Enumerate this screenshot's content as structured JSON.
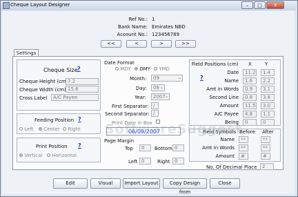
{
  "window": {
    "title": "Cheque Layout Designer",
    "minimize": "–",
    "maximize": "□",
    "close": "✕"
  },
  "header": {
    "ref_label": "Ref No.:",
    "ref_value": "1",
    "bank_label": "Bank Name:",
    "bank_value": "Emirates NBD",
    "account_label": "Account No.:",
    "account_value": "123456789"
  },
  "nav": {
    "first": "<<",
    "prev": "<",
    "next": ">",
    "last": ">>"
  },
  "tabs": {
    "settings": "Settings"
  },
  "cheque_size": {
    "title": "Cheque Size",
    "help": "?",
    "height_label": "Cheque Height (cm)",
    "height_value": "7.2",
    "width_label": "Cheque Width (cm)",
    "width_value": "15.6",
    "cross_label": "Cross Label",
    "cross_value": "A/C Payee"
  },
  "feeding": {
    "title": "Feeding Position",
    "help": "?",
    "left": "Left",
    "center": "Center",
    "right": "Right",
    "selected": "Center"
  },
  "print_position": {
    "title": "Print Position",
    "help": "?",
    "vertical": "Vertical",
    "horizontal": "Horizontal",
    "selected": "Vertical"
  },
  "date_format": {
    "title": "Date Format",
    "mdy": "MDY",
    "dmy": "DMY",
    "ymd": "YMD",
    "selected": "DMY",
    "month_label": "Month:",
    "month_value": "09",
    "day_label": "Day:",
    "day_value": "06",
    "year_label": "Year:",
    "year_value": "2007",
    "first_sep_label": "First Separator:",
    "first_sep_value": "/",
    "second_sep_label": "Second Separator:",
    "second_sep_value": "/",
    "print_in_box_label": "Print Date in Box",
    "preview": "06/09/2007"
  },
  "page_margin": {
    "title": "Page Margin",
    "top_label": "Top",
    "top_value": "0",
    "bottom_label": "Bottom",
    "bottom_value": "0",
    "left_label": "Left",
    "left_value": "0",
    "right_label": "Right",
    "right_value": "0"
  },
  "field_positions": {
    "title": "Field Positions (cm)",
    "help": "?",
    "col_x": "X",
    "col_y": "Y",
    "rows": [
      {
        "label": "Date",
        "x": "11.2",
        "y": "1.4"
      },
      {
        "label": "Name",
        "x": "1.6",
        "y": "2.2"
      },
      {
        "label": "Amt in Words",
        "x": "0.9",
        "y": "3.1"
      },
      {
        "label": "Second Line",
        "x": "0.8",
        "y": "3.8"
      },
      {
        "label": "Amount",
        "x": "11.5",
        "y": "3.0"
      },
      {
        "label": "A/C Payee",
        "x": "4.8",
        "y": "1.1"
      },
      {
        "label": "Being",
        "x": "0",
        "y": "0"
      }
    ]
  },
  "field_symbols": {
    "title": "Field Symbols",
    "col_before": "Before",
    "col_after": "After",
    "rows": [
      {
        "label": "Name",
        "before": "**",
        "after": "**"
      },
      {
        "label": "Amt in Words",
        "before": "**",
        "after": "**"
      },
      {
        "label": "Amount",
        "before": "#",
        "after": "#"
      }
    ],
    "decimal_label": "No. Of Decimal Place",
    "decimal_value": "2"
  },
  "watermark": "SoftwareSuggest",
  "buttons": {
    "edit": "Edit",
    "visual": "Visual",
    "import": "Import Layout",
    "copy": "Copy Design from",
    "close": "Close"
  }
}
